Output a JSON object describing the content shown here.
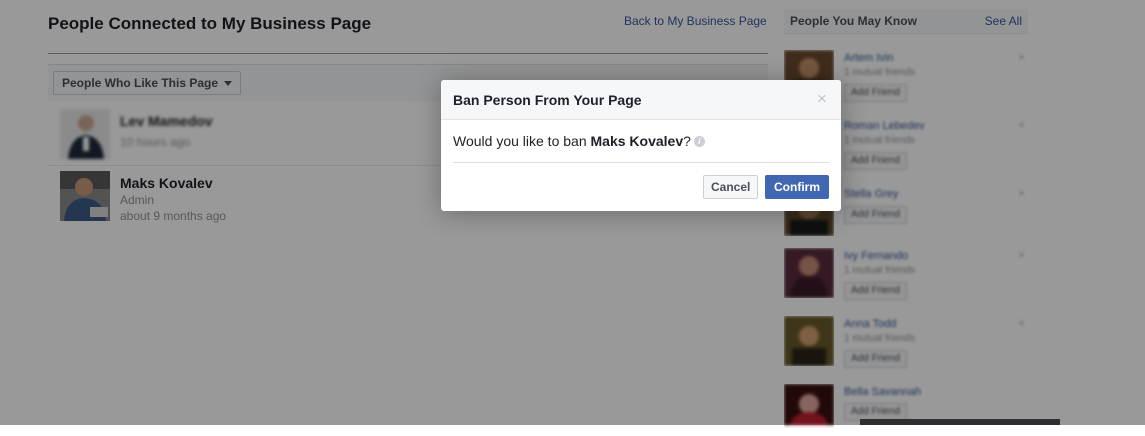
{
  "page": {
    "title": "People Connected to My Business Page",
    "back_link": "Back to My Business Page",
    "filter_label": "People Who Like This Page"
  },
  "people": [
    {
      "name": "Lev Mamedov",
      "role": "",
      "time": "10 hours ago",
      "blurred": true
    },
    {
      "name": "Maks Kovalev",
      "role": "Admin",
      "time": "about 9 months ago",
      "blurred": false
    }
  ],
  "sidebar": {
    "title": "People You May Know",
    "see_all": "See All",
    "items": [
      {
        "name": "Artem Ivin",
        "mutual": "1 mutual friends",
        "button": "Add Friend",
        "close": "×"
      },
      {
        "name": "Roman Lebedev",
        "mutual": "1 mutual friends",
        "button": "Add Friend",
        "close": "×"
      },
      {
        "name": "Stella Grey",
        "mutual": "",
        "button": "Add Friend",
        "close": "×"
      },
      {
        "name": "Ivy Fernando",
        "mutual": "1 mutual friends",
        "button": "Add Friend",
        "close": "×"
      },
      {
        "name": "Anna Todd",
        "mutual": "1 mutual friends",
        "button": "Add Friend",
        "close": "×"
      },
      {
        "name": "Bella Savannah",
        "mutual": "",
        "button": "Add Friend",
        "close": "×"
      }
    ]
  },
  "dialog": {
    "title": "Ban Person From Your Page",
    "close": "×",
    "message_prefix": "Would you like to ban ",
    "person": "Maks Kovalev",
    "message_suffix": "?",
    "info": "i",
    "cancel": "Cancel",
    "confirm": "Confirm"
  },
  "colors": {
    "link": "#365899",
    "confirm_button": "#4267b2",
    "overlay": "rgba(0,0,0,0.4)"
  }
}
